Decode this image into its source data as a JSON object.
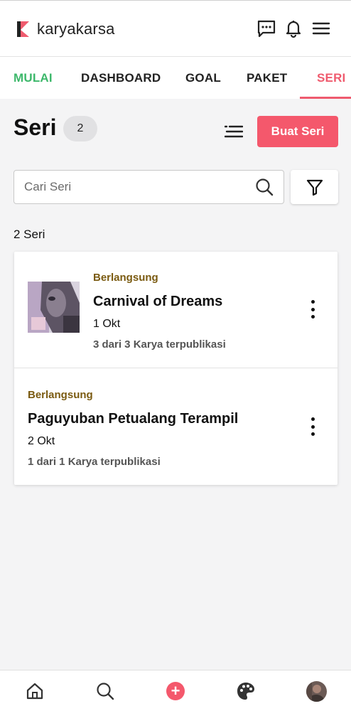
{
  "app": {
    "brand": "karyakarsa"
  },
  "colors": {
    "accent": "#f4586c",
    "green": "#3db86b",
    "status": "#7a5a10"
  },
  "header": {
    "icons": [
      "chat-icon",
      "bell-icon",
      "menu-icon"
    ]
  },
  "tabs": [
    {
      "label": "MULAI"
    },
    {
      "label": "DASHBOARD"
    },
    {
      "label": "GOAL"
    },
    {
      "label": "PAKET"
    },
    {
      "label": "SERI"
    }
  ],
  "page": {
    "title": "Seri",
    "count": "2",
    "create_label": "Buat Seri"
  },
  "search": {
    "placeholder": "Cari Seri",
    "value": ""
  },
  "results": {
    "count_label": "2 Seri",
    "items": [
      {
        "status": "Berlangsung",
        "title": "Carnival of Dreams",
        "date": "1 Okt",
        "meta": "3 dari 3 Karya terpublikasi"
      },
      {
        "status": "Berlangsung",
        "title": "Paguyuban Petualang Terampil",
        "date": "2 Okt",
        "meta": "1 dari 1 Karya terpublikasi"
      }
    ]
  },
  "bottom_nav": [
    "home-icon",
    "search-icon",
    "add-icon",
    "palette-icon",
    "profile-avatar"
  ]
}
